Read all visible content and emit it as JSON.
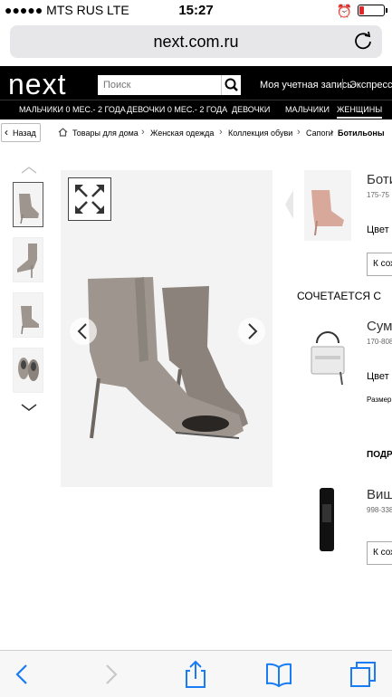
{
  "status": {
    "carrier": "●●●●● MTS RUS   LTE",
    "time": "15:27"
  },
  "browser": {
    "url": "next.com.ru"
  },
  "header": {
    "logo": "next",
    "search_placeholder": "Поиск",
    "account": "Моя учетная запись",
    "express": "Экспресс-м"
  },
  "nav": {
    "items": [
      {
        "label": "МАЛЬЧИКИ 0 МЕС.- 2 ГОДА"
      },
      {
        "label": "ДЕВОЧКИ 0 МЕС.- 2 ГОДА"
      },
      {
        "label": "ДЕВОЧКИ"
      },
      {
        "label": "МАЛЬЧИКИ"
      },
      {
        "label": "ЖЕНЩИНЫ"
      }
    ]
  },
  "breadcrumb": {
    "back": "Назад",
    "items": [
      {
        "label": "Товары для дома"
      },
      {
        "label": "Женская одежда"
      },
      {
        "label": "Коллекция обуви"
      },
      {
        "label": "Сапоги"
      },
      {
        "label": "Ботильоны"
      }
    ]
  },
  "product_panel": {
    "title": "Боти",
    "code": "175-75",
    "color_label": "Цвет",
    "save_button": "К сох"
  },
  "matches": {
    "heading": "СОЧЕТАЕТСЯ С",
    "item1": {
      "title": "Сумо",
      "code": "170-808",
      "color_label": "Цвет",
      "size_label": "Размер"
    },
    "section2": "ПОДР",
    "item2": {
      "title": "Виш",
      "code": "998-338",
      "save_button": "К сох"
    }
  },
  "colors": {
    "boot": "#9d958e",
    "boot_dark": "#8a827b",
    "pink_boot": "#d8a99a",
    "header_bg": "#000000",
    "battery_low": "#e3262c",
    "ios_blue": "#1a7cf5"
  },
  "icons": [
    "search-icon",
    "reload-icon",
    "expand-icon",
    "chevron-left-icon",
    "chevron-right-icon",
    "chevron-up-icon",
    "chevron-down-icon",
    "share-icon",
    "bookmarks-icon",
    "tabs-icon",
    "home-icon"
  ]
}
